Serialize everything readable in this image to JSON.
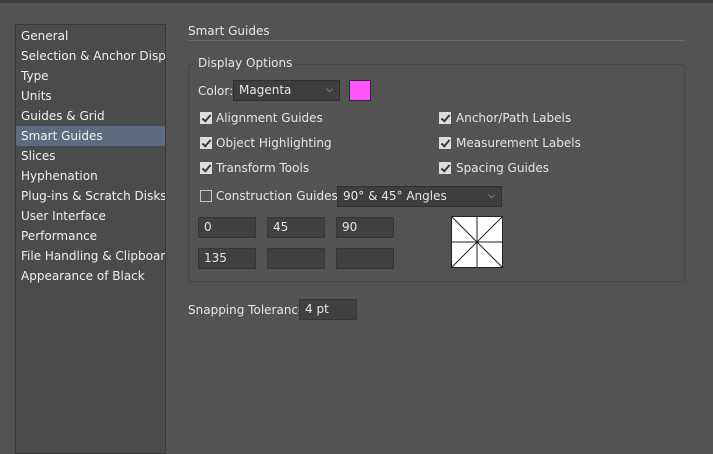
{
  "sidebar": {
    "items": [
      {
        "label": "General"
      },
      {
        "label": "Selection & Anchor Display"
      },
      {
        "label": "Type"
      },
      {
        "label": "Units"
      },
      {
        "label": "Guides & Grid"
      },
      {
        "label": "Smart Guides",
        "selected": true
      },
      {
        "label": "Slices"
      },
      {
        "label": "Hyphenation"
      },
      {
        "label": "Plug-ins & Scratch Disks"
      },
      {
        "label": "User Interface"
      },
      {
        "label": "Performance"
      },
      {
        "label": "File Handling & Clipboard"
      },
      {
        "label": "Appearance of Black"
      }
    ]
  },
  "main": {
    "section_title": "Smart Guides",
    "display_options": {
      "legend": "Display Options",
      "color_label": "Color:",
      "color_value": "Magenta",
      "swatch_color": "#ff55ff",
      "checkboxes": [
        {
          "label": "Alignment Guides",
          "checked": true
        },
        {
          "label": "Object Highlighting",
          "checked": true
        },
        {
          "label": "Transform Tools",
          "checked": true
        },
        {
          "label": "Anchor/Path Labels",
          "checked": true
        },
        {
          "label": "Measurement Labels",
          "checked": true
        },
        {
          "label": "Spacing Guides",
          "checked": true
        }
      ],
      "construction": {
        "label": "Construction Guides:",
        "checked": false,
        "angles_value": "90° & 45° Angles"
      },
      "angle_fields": [
        "0",
        "45",
        "90",
        "135",
        "",
        ""
      ]
    },
    "snapping": {
      "label": "Snapping Tolerance:",
      "value": "4 pt"
    }
  }
}
